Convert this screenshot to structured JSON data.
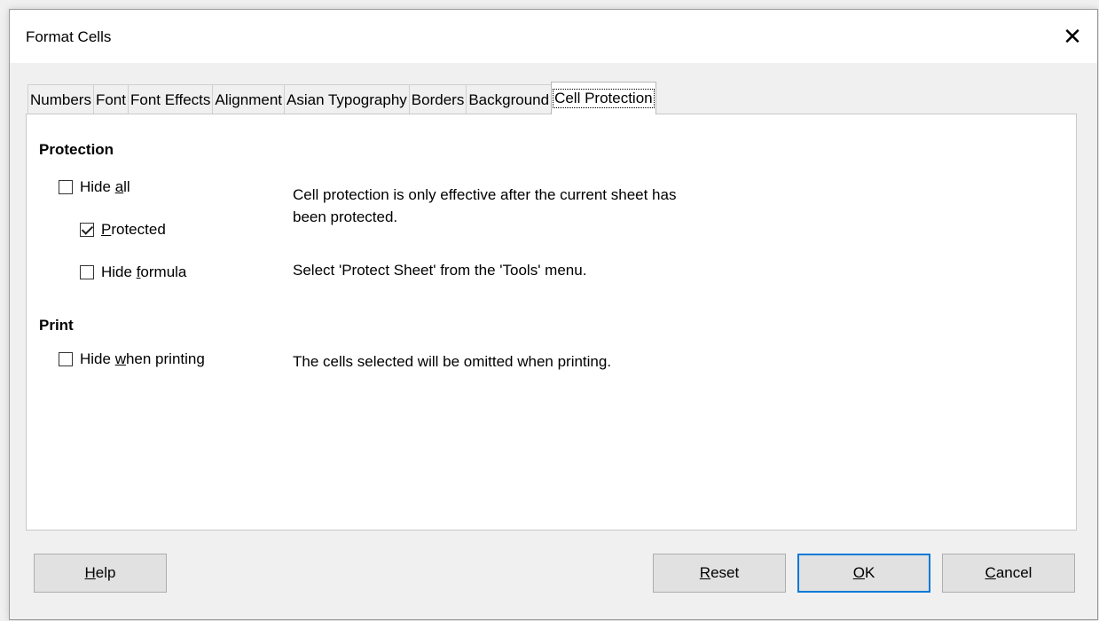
{
  "window": {
    "title": "Format Cells"
  },
  "tabs": [
    {
      "label": "Numbers"
    },
    {
      "label": "Font"
    },
    {
      "label": "Font Effects"
    },
    {
      "label": "Alignment"
    },
    {
      "label": "Asian Typography"
    },
    {
      "label": "Borders"
    },
    {
      "label": "Background"
    },
    {
      "label": "Cell Protection",
      "active": true
    }
  ],
  "protection": {
    "heading": "Protection",
    "hide_all": {
      "pre": "Hide ",
      "accel": "a",
      "post": "ll",
      "checked": false
    },
    "protected": {
      "pre": "",
      "accel": "P",
      "post": "rotected",
      "checked": true
    },
    "hide_formula": {
      "pre": "Hide ",
      "accel": "f",
      "post": "ormula",
      "checked": false
    },
    "info_line1": "Cell protection is only effective after the current sheet has",
    "info_line2": "been protected.",
    "info_tools": "Select 'Protect Sheet' from the 'Tools' menu."
  },
  "print": {
    "heading": "Print",
    "hide_when_printing": {
      "pre": "Hide ",
      "accel": "w",
      "post": "hen printing",
      "checked": false
    },
    "info": "The cells selected will be omitted when printing."
  },
  "buttons": {
    "help": {
      "accel": "H",
      "post": "elp"
    },
    "reset": {
      "accel": "R",
      "post": "eset"
    },
    "ok": {
      "accel": "O",
      "post": "K"
    },
    "cancel": {
      "accel": "C",
      "post": "ancel"
    }
  },
  "colors": {
    "accent": "#0078d7"
  }
}
